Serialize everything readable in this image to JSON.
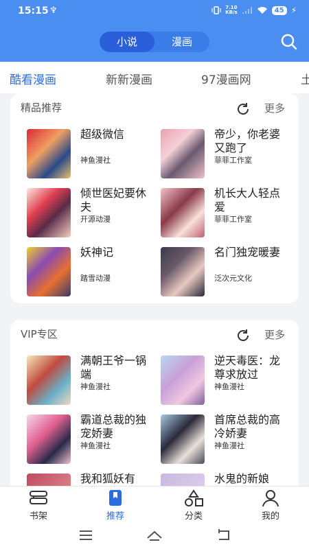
{
  "status": {
    "time": "15:15",
    "net_speed_top": "7.10",
    "net_speed_bottom": "KB/s",
    "battery": "45"
  },
  "header": {
    "seg_novel": "小说",
    "seg_comic": "漫画"
  },
  "tabs": [
    "酷看漫画",
    "新新漫画",
    "97漫画网",
    "土"
  ],
  "sections": [
    {
      "title": "精品推荐",
      "more": "更多",
      "items": [
        {
          "title": "超级微信",
          "publisher": "神鱼漫社"
        },
        {
          "title": "帝少，你老婆又跑了",
          "publisher": "菲菲工作室"
        },
        {
          "title": "倾世医妃要休夫",
          "publisher": "开源动漫"
        },
        {
          "title": "机长大人轻点爱",
          "publisher": "菲菲工作室"
        },
        {
          "title": "妖神记",
          "publisher": "踏雪动漫"
        },
        {
          "title": "名门独宠暖妻",
          "publisher": "泛次元文化"
        }
      ]
    },
    {
      "title": "VIP专区",
      "more": "更多",
      "items": [
        {
          "title": "满朝王爷一锅端",
          "publisher": "神鱼漫社"
        },
        {
          "title": "逆天毒医：龙尊求放过",
          "publisher": "神鱼漫社"
        },
        {
          "title": "霸道总裁的独宠娇妻",
          "publisher": "神鱼漫社"
        },
        {
          "title": "首席总裁的高冷娇妻",
          "publisher": "神鱼漫社"
        },
        {
          "title": "我和狐妖有",
          "publisher": ""
        },
        {
          "title": "水鬼的新娘",
          "publisher": ""
        }
      ]
    }
  ],
  "nav": [
    {
      "label": "书架",
      "icon": "bookshelf-icon"
    },
    {
      "label": "推荐",
      "icon": "bookmark-icon"
    },
    {
      "label": "分类",
      "icon": "category-icon"
    },
    {
      "label": "我的",
      "icon": "user-icon"
    }
  ],
  "colors": {
    "primary": "#4b8ef1",
    "accent": "#2b6de0",
    "segment_active": "#2b5fd9"
  }
}
